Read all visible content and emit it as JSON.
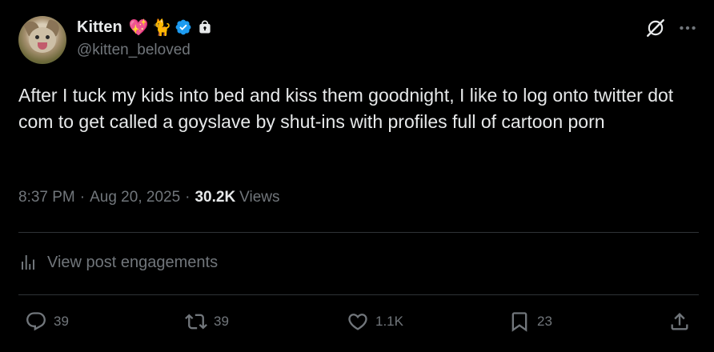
{
  "author": {
    "display_name": "Kitten",
    "emojis": [
      "💖",
      "🐈"
    ],
    "verified_icon": "verified-badge-icon",
    "lock_icon": "lock-icon",
    "handle": "@kitten_beloved",
    "avatar_icon": "kitten-avatar"
  },
  "header_actions": {
    "grok_icon": "grok-icon",
    "more_icon": "more-icon"
  },
  "tweet": {
    "text": "After I tuck my kids into bed and kiss them goodnight, I like to log onto twitter dot com to get called a goyslave by shut-ins with profiles full of cartoon porn"
  },
  "meta": {
    "time": "8:37 PM",
    "separator": "·",
    "date": "Aug 20, 2025",
    "views_count": "30.2K",
    "views_label": "Views"
  },
  "engagements": {
    "label": "View post engagements",
    "icon": "analytics-icon"
  },
  "actions": {
    "replies": "39",
    "retweets": "39",
    "likes": "1.1K",
    "bookmarks": "23"
  },
  "colors": {
    "background": "#000000",
    "text": "#e7e9ea",
    "muted": "#71767b",
    "divider": "#2f3336",
    "verified": "#1d9bf0"
  }
}
